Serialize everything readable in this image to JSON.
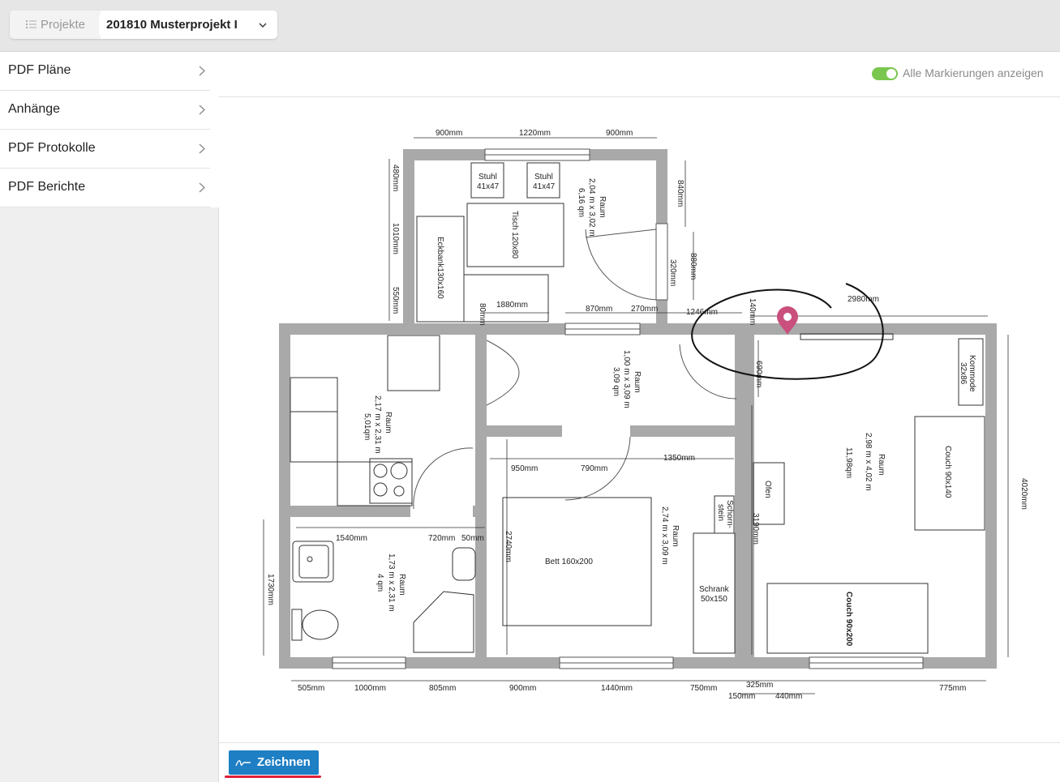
{
  "header": {
    "projects_label": "Projekte",
    "project_selected": "201810 Musterprojekt I"
  },
  "sidebar": {
    "items": [
      {
        "label": "PDF Pläne"
      },
      {
        "label": "Anhänge"
      },
      {
        "label": "PDF Protokolle"
      },
      {
        "label": "PDF Berichte"
      }
    ]
  },
  "toolbar": {
    "show_all_markers_label": "Alle Markierungen anzeigen",
    "show_all_markers_on": true
  },
  "plan": {
    "labels": {
      "d_top_left": "900mm",
      "d_top_mid": "1220mm",
      "d_top_right": "900mm",
      "d_480": "480mm",
      "d_1010": "1010mm",
      "d_550": "550mm",
      "d_840": "840mm",
      "d_880": "880mm",
      "d_320": "320mm",
      "stuhl_a": "Stuhl",
      "stuhl_a_size": "41x47",
      "stuhl_b": "Stuhl",
      "stuhl_b_size": "41x47",
      "tisch": "Tisch 120x80",
      "eckbank": "Eckbank130x160",
      "raum1_a": "Raum",
      "raum1_b": "2,04 m x 3,02 m",
      "raum1_c": "6,16 qm",
      "d_1880": "1880mm",
      "d_80": "80mm",
      "d_870": "870mm",
      "d_270": "270mm",
      "d_1246": "1246mm",
      "d_140": "140mm",
      "d_2980": "2980mm",
      "kommode": "Kommode",
      "kommode_size": "32x86",
      "d_690": "690mm",
      "raum2_a": "Raum",
      "raum2_b": "1,00 m x 3,09 m",
      "raum2_c": "3,09 qm",
      "raum3_a": "Raum",
      "raum3_b": "2,17 m x 2,31 m",
      "raum3_c": "5,01qm",
      "raum4_a": "Raum",
      "raum4_b": "2,98 m x 4,02 m",
      "raum4_c": "11,98qm",
      "couch1": "Couch 90x140",
      "d_4020": "4020mm",
      "d_950": "950mm",
      "d_790": "790mm",
      "d_1350": "1350mm",
      "ofen": "Ofen",
      "schorn_a": "Schorn-",
      "schorn_b": "stein",
      "d_3190": "3190mm",
      "d_1540": "1540mm",
      "d_720": "720mm",
      "d_50": "50mm",
      "d_2740": "2740mm",
      "raum5_a": "Raum",
      "raum5_b": "2,74 m x 3,09 m",
      "bett": "Bett 160x200",
      "schrank": "Schrank",
      "schrank_size": "50x150",
      "d_1730": "1730mm",
      "raum6_a": "Raum",
      "raum6_b": "1,73 m x 2,31 m",
      "raum6_c": "4 qm",
      "couch2": "Couch 90x200",
      "b_505": "505mm",
      "b_1000": "1000mm",
      "b_805": "805mm",
      "b_900": "900mm",
      "b_1440": "1440mm",
      "b_750": "750mm",
      "b_150": "150mm",
      "b_325": "325mm",
      "b_440": "440mm",
      "b_775": "775mm"
    }
  },
  "actions": {
    "draw_label": "Zeichnen"
  },
  "colors": {
    "wall": "#a9a9a9",
    "marker": "#c94f7c",
    "toggle_on": "#7ac74f",
    "button": "#1e7fc4",
    "underline": "#e0203a"
  }
}
